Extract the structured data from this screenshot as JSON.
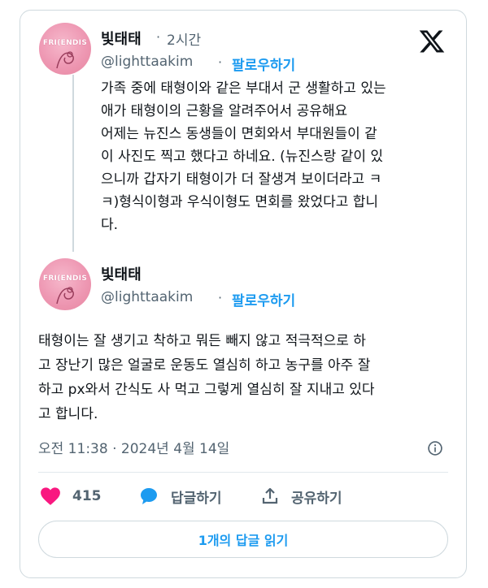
{
  "tweet1": {
    "name": "빛태태",
    "separator": "·",
    "time": "2시간",
    "handle": "@lighttaakim",
    "follow_sep": "·",
    "follow": "팔로우하기",
    "avatar_text": "FRI(ENDIS",
    "lines": [
      "가족 중에 태형이와 같은 부대서 군 생활하고 있는",
      "애가 태형이의 근황을 알려주어서 공유해요",
      "어제는 뉴진스 동생들이 면회와서  부대원들이 같",
      "이 사진도 찍고 했다고 하네요. (뉴진스랑 같이 있",
      "으니까 갑자기 태형이가 더 잘생겨 보이더라고 ㅋ",
      "ㅋ)형식이형과 우식이형도 면회를 왔었다고 합니",
      "다."
    ]
  },
  "tweet2": {
    "name": "빛태태",
    "handle": "@lighttaakim",
    "follow_sep": "·",
    "follow": "팔로우하기",
    "avatar_text": "FRI(ENDIS",
    "lines": [
      "태형이는 잘 생기고 착하고 뭐든 빼지 않고 적극적으로 하",
      "고 장난기 많은 얼굴로 운동도 열심히 하고 농구를 아주 잘",
      "하고 px와서 간식도 사 먹고 그렇게 열심히 잘 지내고 있다",
      "고 합니다."
    ],
    "timestamp": "오전 11:38 · 2024년 4월 14일"
  },
  "actions": {
    "like_count": "415",
    "reply_label": "답글하기",
    "share_label": "공유하기"
  },
  "read_replies": "1개의 답글 읽기",
  "colors": {
    "accent": "#1d9bf0",
    "like": "#f91880",
    "muted": "#536471",
    "border": "#cfd9de",
    "avatar": "#ee98b3"
  },
  "icons": {
    "x_logo": "x-logo-icon",
    "info": "info-icon",
    "heart": "heart-icon",
    "reply": "reply-bubble-icon",
    "share": "share-icon"
  }
}
